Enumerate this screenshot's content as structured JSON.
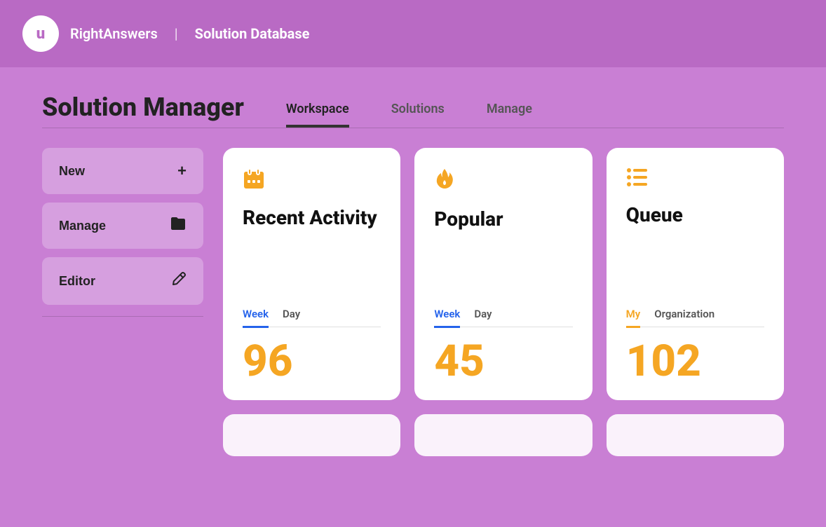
{
  "header": {
    "logo_letter": "u",
    "app_name": "RightAnswers",
    "divider": "|",
    "section": "Solution Database"
  },
  "page": {
    "title": "Solution Manager",
    "tabs": [
      {
        "id": "workspace",
        "label": "Workspace",
        "active": true
      },
      {
        "id": "solutions",
        "label": "Solutions",
        "active": false
      },
      {
        "id": "manage",
        "label": "Manage",
        "active": false
      }
    ]
  },
  "sidebar": {
    "buttons": [
      {
        "id": "new",
        "label": "New",
        "icon": "+"
      },
      {
        "id": "manage",
        "label": "Manage",
        "icon": "folder"
      },
      {
        "id": "editor",
        "label": "Editor",
        "icon": "edit"
      }
    ]
  },
  "cards": [
    {
      "id": "recent-activity",
      "icon": "calendar",
      "title": "Recent Activity",
      "tabs": [
        {
          "label": "Week",
          "active": true,
          "color": "blue"
        },
        {
          "label": "Day",
          "active": false
        }
      ],
      "value": "96"
    },
    {
      "id": "popular",
      "icon": "fire",
      "title": "Popular",
      "tabs": [
        {
          "label": "Week",
          "active": true,
          "color": "blue"
        },
        {
          "label": "Day",
          "active": false
        }
      ],
      "value": "45"
    },
    {
      "id": "queue",
      "icon": "list",
      "title": "Queue",
      "tabs": [
        {
          "label": "My",
          "active": true,
          "color": "orange"
        },
        {
          "label": "Organization",
          "active": false
        }
      ],
      "value": "102"
    }
  ]
}
